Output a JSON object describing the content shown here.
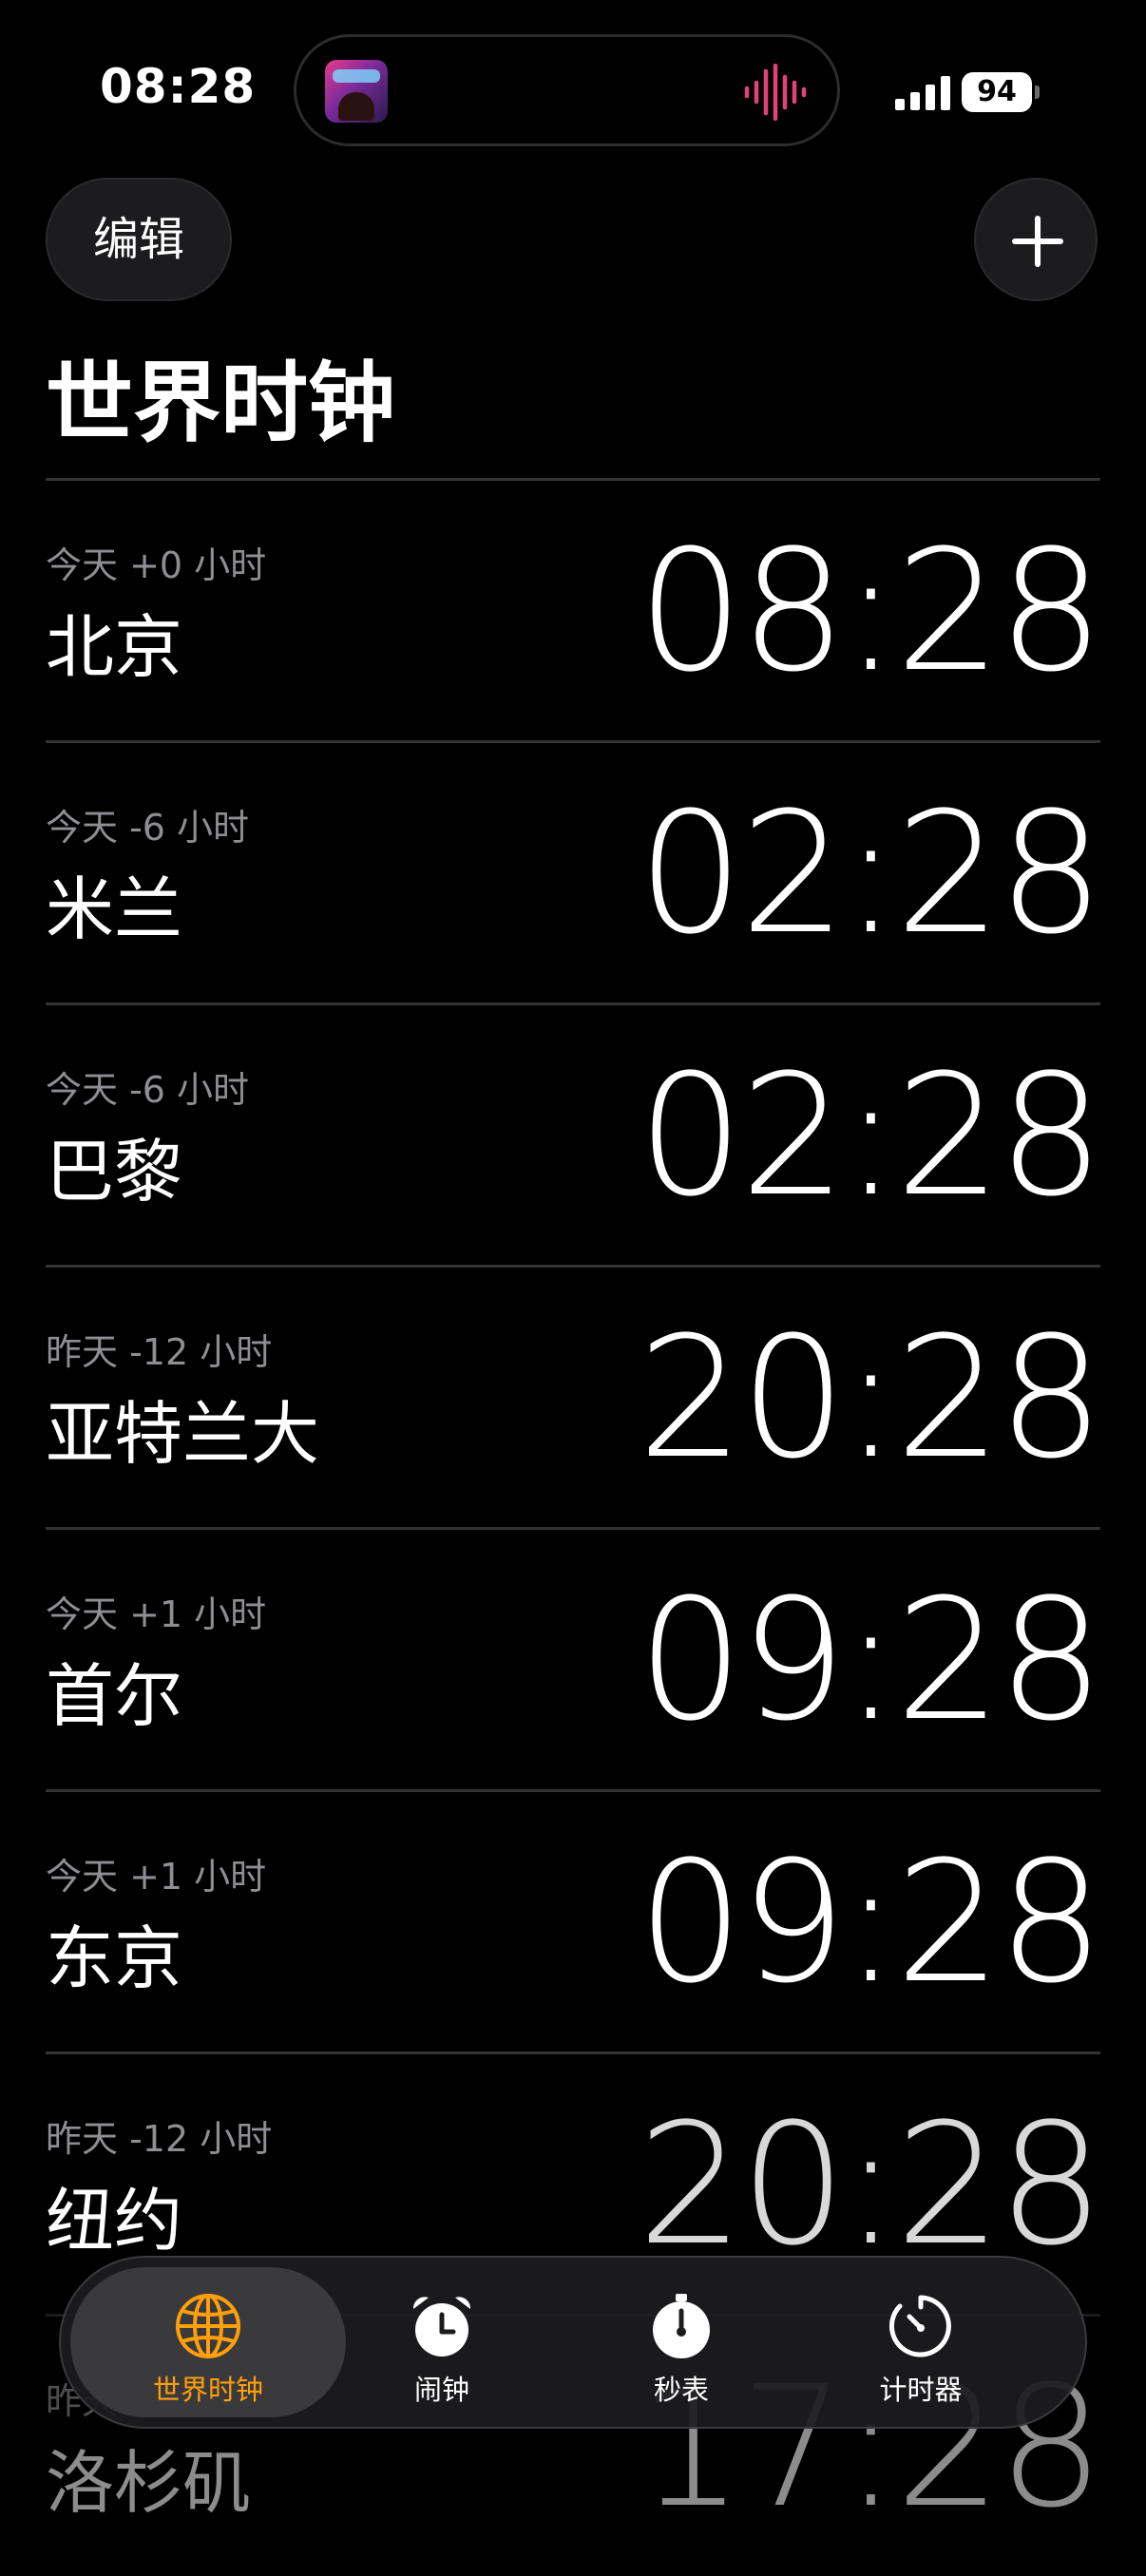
{
  "status_bar": {
    "time": "08:28",
    "battery": "94"
  },
  "header": {
    "edit_label": "编辑",
    "title": "世界时钟"
  },
  "clocks": [
    {
      "offset": "今天 +0 小时",
      "city": "北京",
      "time": "08:28"
    },
    {
      "offset": "今天 -6 小时",
      "city": "米兰",
      "time": "02:28"
    },
    {
      "offset": "今天 -6 小时",
      "city": "巴黎",
      "time": "02:28"
    },
    {
      "offset": "昨天 -12 小时",
      "city": "亚特兰大",
      "time": "20:28"
    },
    {
      "offset": "今天 +1 小时",
      "city": "首尔",
      "time": "09:28"
    },
    {
      "offset": "今天 +1 小时",
      "city": "东京",
      "time": "09:28"
    },
    {
      "offset": "昨天 -12 小时",
      "city": "纽约",
      "time": "20:28"
    },
    {
      "offset": "昨天",
      "city": "洛杉矶",
      "time": "17:28"
    }
  ],
  "tabs": [
    {
      "label": "世界时钟",
      "icon": "globe-icon",
      "active": true
    },
    {
      "label": "闹钟",
      "icon": "alarm-clock-icon",
      "active": false
    },
    {
      "label": "秒表",
      "icon": "stopwatch-icon",
      "active": false
    },
    {
      "label": "计时器",
      "icon": "timer-icon",
      "active": false
    }
  ],
  "colors": {
    "background": "#000000",
    "accent": "#ff9f0a",
    "secondary_text": "#8e8e93",
    "separator": "#333336",
    "waveform": "#e0427a"
  }
}
